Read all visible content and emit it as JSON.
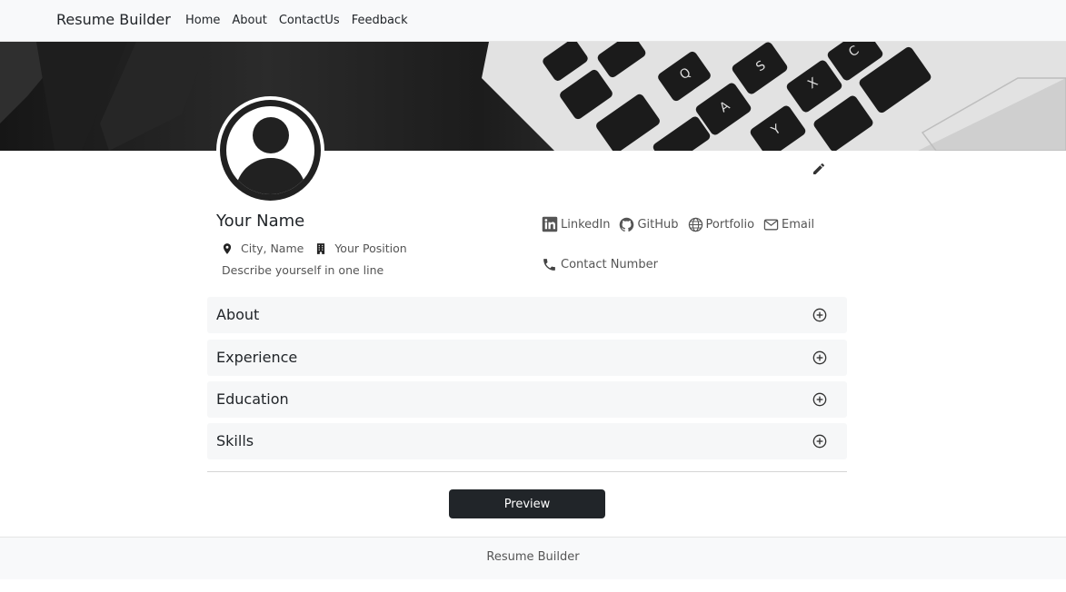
{
  "navbar": {
    "brand": "Resume Builder",
    "links": [
      "Home",
      "About",
      "ContactUs",
      "Feedback"
    ]
  },
  "profile": {
    "name": "Your Name",
    "location": "City, Name",
    "position": "Your Position",
    "tagline": "Describe yourself in one line",
    "links": {
      "linkedin": "LinkedIn",
      "github": "GitHub",
      "portfolio": "Portfolio",
      "email": "Email"
    },
    "contact": "Contact Number"
  },
  "sections": [
    "About",
    "Experience",
    "Education",
    "Skills"
  ],
  "actions": {
    "preview": "Preview"
  },
  "footer": {
    "text": "Resume Builder"
  },
  "icons": {
    "avatar": "person-avatar-icon",
    "edit": "pencil-icon",
    "location": "map-pin-icon",
    "position": "building-icon",
    "linkedin": "linkedin-icon",
    "github": "github-icon",
    "portfolio": "globe-icon",
    "email": "envelope-icon",
    "contact": "phone-icon",
    "section_toggle": "plus-circle-icon"
  }
}
